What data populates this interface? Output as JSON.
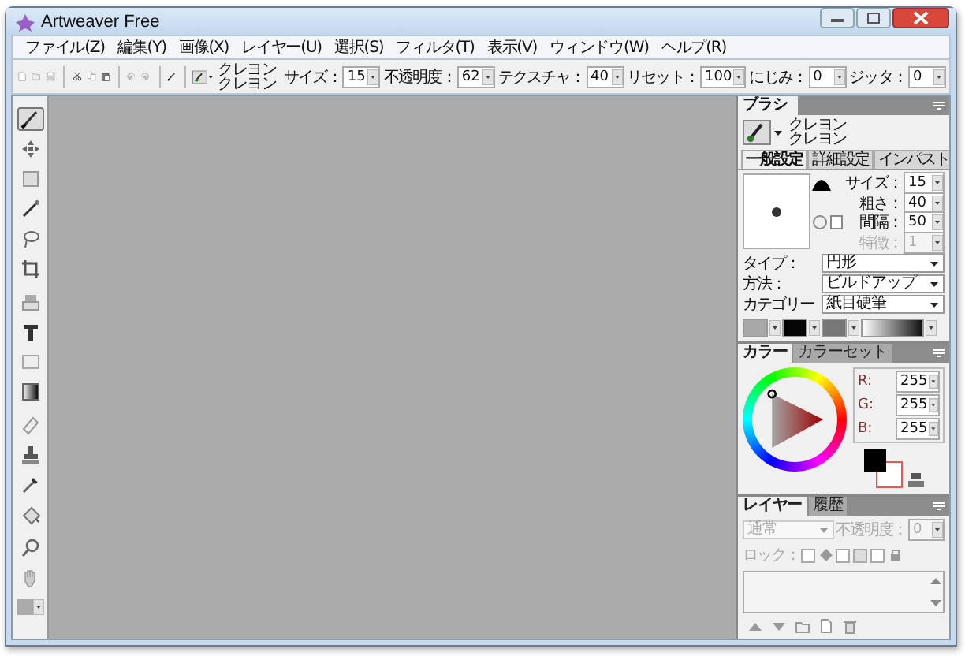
{
  "window": {
    "title": "Artweaver Free"
  },
  "menu": [
    "ファイル(Z)",
    "編集(Y)",
    "画像(X)",
    "レイヤー(U)",
    "選択(S)",
    "フィルタ(T)",
    "表示(V)",
    "ウィンドウ(W)",
    "ヘルプ(R)"
  ],
  "toolbar": {
    "buttons": [
      {
        "kind": "new"
      },
      {
        "kind": "open"
      },
      {
        "kind": "save"
      },
      {
        "kind": "sep"
      },
      {
        "kind": "cut"
      },
      {
        "kind": "copy"
      },
      {
        "kind": "paste"
      },
      {
        "kind": "sep"
      },
      {
        "kind": "undo"
      },
      {
        "kind": "redo"
      },
      {
        "kind": "sep"
      },
      {
        "kind": "brush"
      },
      {
        "kind": "sep"
      }
    ],
    "preset_names": [
      "クレヨン",
      "クレヨン"
    ],
    "fields": [
      {
        "label": "サイズ：",
        "value": "15"
      },
      {
        "label": "不透明度：",
        "value": "62"
      },
      {
        "label": "テクスチャ：",
        "value": "40"
      },
      {
        "label": "リセット：",
        "value": "100"
      },
      {
        "label": "にじみ：",
        "value": "0"
      },
      {
        "label": "ジッタ：",
        "value": "0"
      }
    ]
  },
  "tools": [
    {
      "kind": "brush",
      "selected": true
    },
    {
      "kind": "move",
      "selected": false
    },
    {
      "kind": "marquee",
      "selected": false
    },
    {
      "kind": "wand",
      "selected": false
    },
    {
      "kind": "lasso",
      "selected": false
    },
    {
      "kind": "crop",
      "selected": false
    },
    {
      "kind": "sep"
    },
    {
      "kind": "clone",
      "selected": false
    },
    {
      "kind": "text",
      "selected": false
    },
    {
      "kind": "shape",
      "selected": false
    },
    {
      "kind": "gradient",
      "selected": false
    },
    {
      "kind": "sep"
    },
    {
      "kind": "eraser",
      "selected": false
    },
    {
      "kind": "stamp",
      "selected": false
    },
    {
      "kind": "eyedropper",
      "selected": false
    },
    {
      "kind": "bucket",
      "selected": false
    },
    {
      "kind": "sep"
    },
    {
      "kind": "zoom",
      "selected": false
    },
    {
      "kind": "hand",
      "selected": false
    }
  ],
  "brush_panel": {
    "title": "ブラシ",
    "preset_names": [
      "クレヨン",
      "クレヨン"
    ],
    "tabs": [
      {
        "label": "一般設定",
        "selected": true
      },
      {
        "label": "詳細設定",
        "selected": false
      },
      {
        "label": "インパスト",
        "selected": false
      }
    ],
    "fields": [
      {
        "label": "サイズ：",
        "value": "15",
        "disabled": false
      },
      {
        "label": "粗さ：",
        "value": "40",
        "disabled": false
      },
      {
        "label": "間隔：",
        "value": "50",
        "disabled": false
      },
      {
        "label": "特徴：",
        "value": "1",
        "disabled": true
      }
    ],
    "dropdowns": [
      {
        "label": "タイプ：",
        "value": "円形"
      },
      {
        "label": "方法：",
        "value": "ビルドアップ"
      },
      {
        "label": "カテゴリー",
        "value": "紙目硬筆"
      }
    ]
  },
  "color_panel": {
    "tabs": [
      {
        "label": "カラー",
        "selected": true
      },
      {
        "label": "カラーセット",
        "selected": false
      }
    ],
    "fields": [
      {
        "label": "R:",
        "value": "255"
      },
      {
        "label": "G:",
        "value": "255"
      },
      {
        "label": "B:",
        "value": "255"
      }
    ]
  },
  "layer_panel": {
    "tabs": [
      {
        "label": "レイヤー",
        "selected": true
      },
      {
        "label": "履歴",
        "selected": false
      }
    ],
    "blend_mode": {
      "value": "通常",
      "disabled": true
    },
    "opacity": {
      "label": "不透明度：",
      "value": "0",
      "disabled": true
    },
    "lock_label": "ロック："
  }
}
